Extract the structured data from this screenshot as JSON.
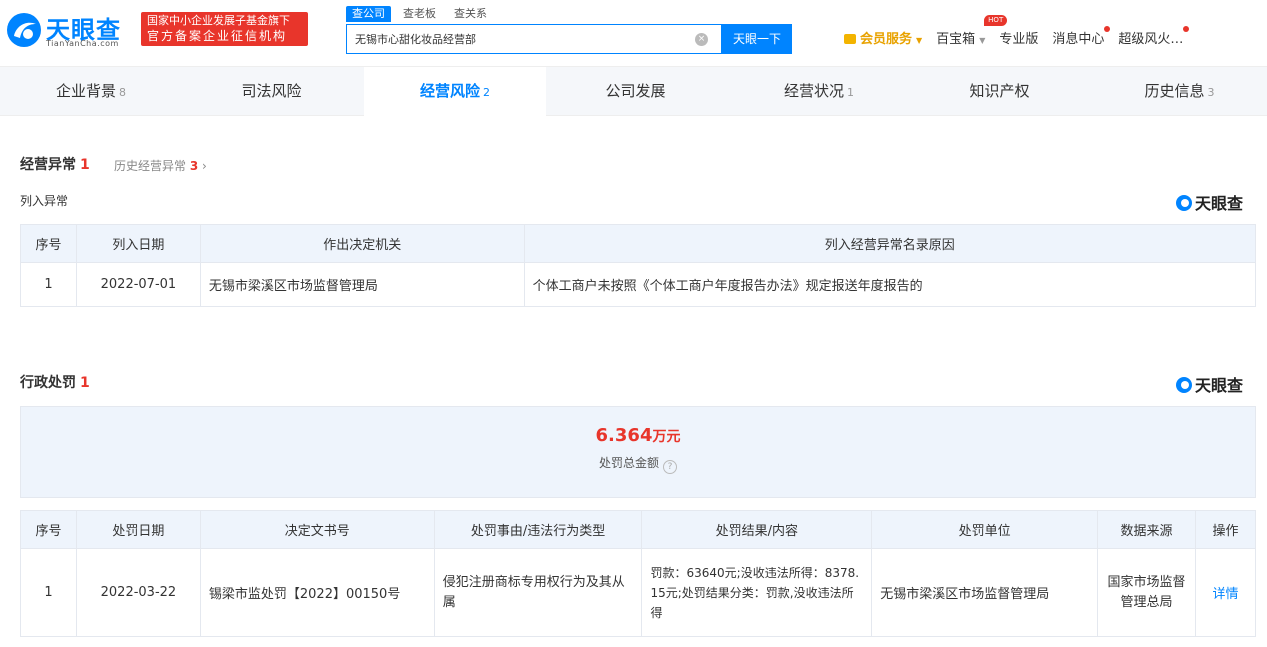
{
  "header": {
    "logo_text": "天眼查",
    "logo_sub": "TianYanCha.com",
    "gov_badge_line1": "国家中小企业发展子基金旗下",
    "gov_badge_line2": "官方备案企业征信机构",
    "search_tabs": [
      "查公司",
      "查老板",
      "查关系"
    ],
    "search_value": "无锡市心甜化妆品经营部",
    "search_clear": "×",
    "search_button": "天眼一下",
    "nav": {
      "vip": "会员服务",
      "toolbox": "百宝箱",
      "hot": "HOT",
      "pro": "专业版",
      "messages": "消息中心",
      "user": "超级风火…"
    }
  },
  "tabs": [
    {
      "label": "企业背景",
      "count": "8"
    },
    {
      "label": "司法风险",
      "count": ""
    },
    {
      "label": "经营风险",
      "count": "2"
    },
    {
      "label": "公司发展",
      "count": ""
    },
    {
      "label": "经营状况",
      "count": "1"
    },
    {
      "label": "知识产权",
      "count": ""
    },
    {
      "label": "历史信息",
      "count": "3"
    }
  ],
  "abnormal": {
    "title": "经营异常",
    "count": "1",
    "history_label": "历史经营异常",
    "history_count": "3",
    "sub_title": "列入异常",
    "brand": "天眼查",
    "columns": [
      "序号",
      "列入日期",
      "作出决定机关",
      "列入经营异常名录原因"
    ],
    "rows": [
      [
        "1",
        "2022-07-01",
        "无锡市梁溪区市场监督管理局",
        "个体工商户未按照《个体工商户年度报告办法》规定报送年度报告的"
      ]
    ]
  },
  "penalty": {
    "title": "行政处罚",
    "count": "1",
    "brand": "天眼查",
    "total_amount": "6.364",
    "total_unit": "万元",
    "total_label": "处罚总金额",
    "help": "?",
    "columns": [
      "序号",
      "处罚日期",
      "决定文书号",
      "处罚事由/违法行为类型",
      "处罚结果/内容",
      "处罚单位",
      "数据来源",
      "操作"
    ],
    "rows": [
      [
        "1",
        "2022-03-22",
        "锡梁市监处罚【2022】00150号",
        "侵犯注册商标专用权行为及其从属",
        "罚款：63640元;没收违法所得：8378.15元;处罚结果分类：罚款,没收违法所得",
        "无锡市梁溪区市场监督管理局",
        "国家市场监督管理总局",
        "详情"
      ]
    ]
  }
}
